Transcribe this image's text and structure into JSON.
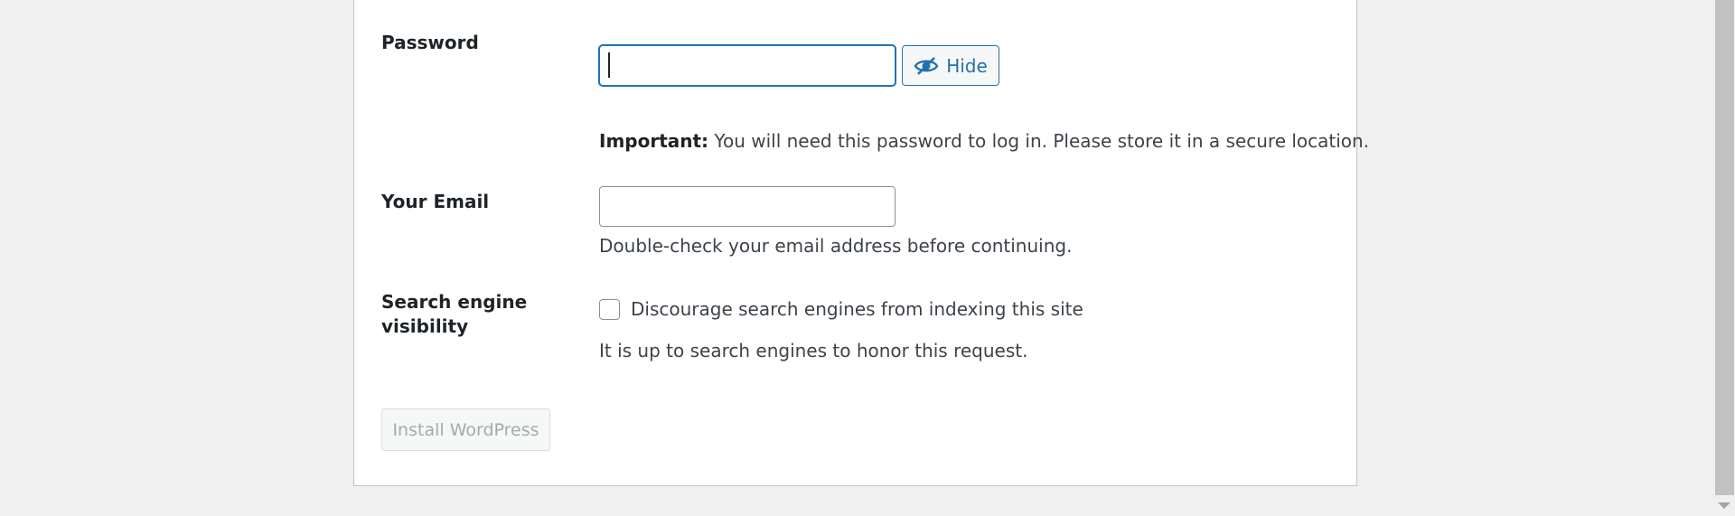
{
  "form": {
    "password": {
      "label": "Password",
      "value": "",
      "toggle_label": "Hide",
      "toggle_icon": "eye-slash-icon",
      "important_prefix": "Important:",
      "important_text": " You will need this password to log in. Please store it in a secure location."
    },
    "email": {
      "label": "Your Email",
      "value": "",
      "description": "Double-check your email address before continuing."
    },
    "search_visibility": {
      "label_line1": "Search engine",
      "label_line2": "visibility",
      "checkbox_label": "Discourage search engines from indexing this site",
      "checked": false,
      "description": "It is up to search engines to honor this request."
    },
    "submit_label": "Install WordPress"
  },
  "colors": {
    "accent": "#2271b1",
    "background": "#f0f0f1",
    "card": "#ffffff",
    "disabled_text": "#a7aaad"
  }
}
